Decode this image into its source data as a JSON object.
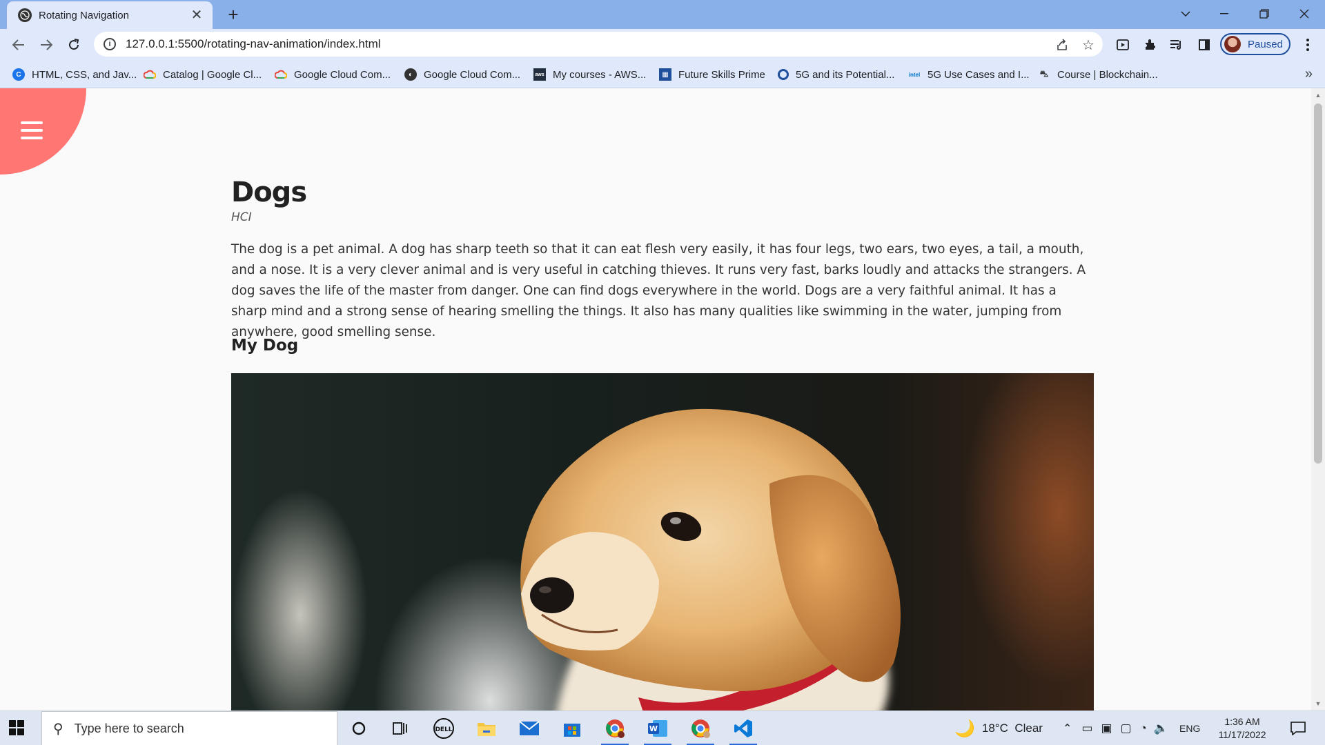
{
  "browser": {
    "tab_title": "Rotating Navigation",
    "url": "127.0.0.1:5500/rotating-nav-animation/index.html",
    "profile_label": "Paused",
    "bookmarks": [
      {
        "label": "HTML, CSS, and Jav...",
        "icon": "c-logo-icon",
        "color": "#1a73e8"
      },
      {
        "label": "Catalog | Google Cl...",
        "icon": "google-cloud-icon",
        "color": "#ea4335"
      },
      {
        "label": "Google Cloud Com...",
        "icon": "google-cloud-icon",
        "color": "#ea4335"
      },
      {
        "label": "Google Cloud Com...",
        "icon": "globe-icon",
        "color": "#333333"
      },
      {
        "label": "My courses - AWS...",
        "icon": "aws-icon",
        "color": "#232f3e"
      },
      {
        "label": "Future Skills Prime",
        "icon": "future-skills-icon",
        "color": "#1f4f9c"
      },
      {
        "label": "5G and its Potential...",
        "icon": "ring-icon",
        "color": "#1f4f9c"
      },
      {
        "label": "5G Use Cases and I...",
        "icon": "intel-icon",
        "color": "#0071c5"
      },
      {
        "label": "Course | Blockchain...",
        "icon": "course-icon",
        "color": "#333333"
      }
    ]
  },
  "page": {
    "title": "Dogs",
    "subtitle": "HCI",
    "paragraph": "The dog is a pet animal. A dog has sharp teeth so that it can eat flesh very easily, it has four legs, two ears, two eyes, a tail, a mouth, and a nose. It is a very clever animal and is very useful in catching thieves. It runs very fast, barks loudly and attacks the strangers. A dog saves the life of the master from danger. One can find dogs everywhere in the world. Dogs are a very faithful animal. It has a sharp mind and a strong sense of hearing smelling the things. It also has many qualities like swimming in the water, jumping from anywhere, good smelling sense.",
    "subheading": "My Dog",
    "nav_color": "#ff7673"
  },
  "taskbar": {
    "search_placeholder": "Type here to search",
    "weather": "18°C  Clear",
    "language": "ENG",
    "time": "1:36 AM",
    "date": "11/17/2022"
  }
}
